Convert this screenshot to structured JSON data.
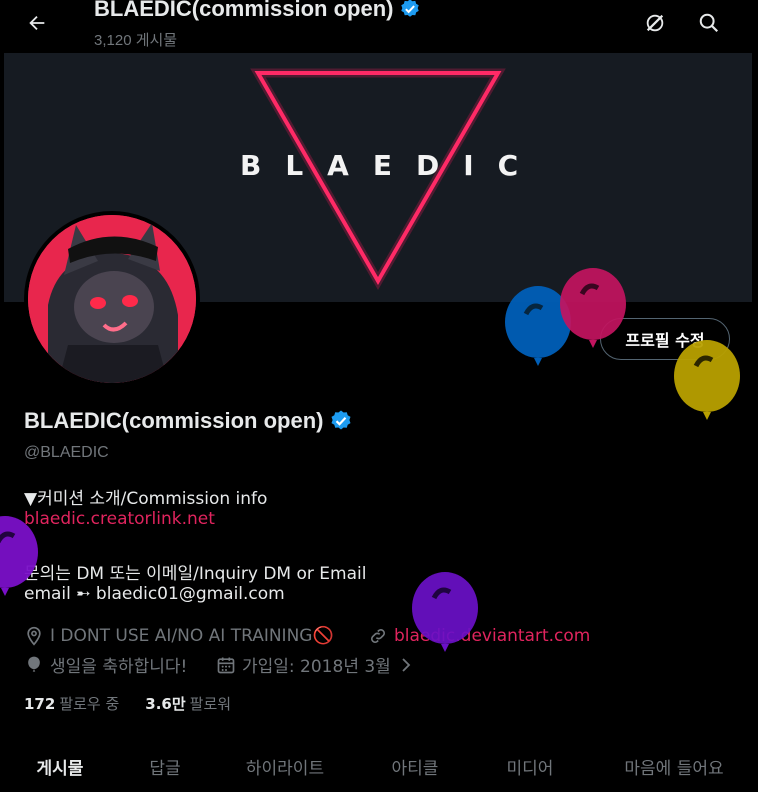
{
  "header": {
    "title": "BLAEDIC(commission open)",
    "post_count": "3,120 게시물"
  },
  "banner": {
    "logo_text": "BLAEDIC"
  },
  "profile": {
    "edit_button": "프로필 수정",
    "name": "BLAEDIC(commission open)",
    "handle": "@BLAEDIC",
    "bio_line1": "▼커미션 소개/Commission info",
    "bio_link": "blaedic.creatorlink.net",
    "bio_line3": "문의는 DM 또는 이메일/Inquiry DM or Email",
    "bio_line4": "email ➸ blaedic01@gmail.com",
    "location": "I DONT USE AI/NO AI TRAINING🚫",
    "website": "blaedic.deviantart.com",
    "birthday": "생일을 축하합니다!",
    "joined": "가입일: 2018년 3월",
    "following_count": "172",
    "following_label": "팔로우 중",
    "followers_count": "3.6만",
    "followers_label": "팔로워"
  },
  "tabs": [
    {
      "label": "게시물"
    },
    {
      "label": "답글"
    },
    {
      "label": "하이라이트"
    },
    {
      "label": "아티클"
    },
    {
      "label": "미디어"
    },
    {
      "label": "마음에 들어요"
    }
  ],
  "colors": {
    "accent_link": "#e0245e",
    "verified": "#1d9bf0",
    "neon": "#ff1a5e",
    "balloons": [
      "#005fb8",
      "#c3145f",
      "#b8a000",
      "#6a10c8",
      "#7a10c8"
    ]
  },
  "icons": [
    "back-arrow-icon",
    "grok-icon",
    "search-icon",
    "verified-badge-icon",
    "location-icon",
    "link-icon",
    "balloon-icon",
    "calendar-icon",
    "chevron-right-icon"
  ]
}
